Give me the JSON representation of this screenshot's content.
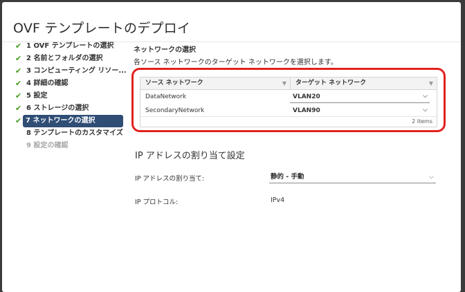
{
  "dialog": {
    "title": "OVF テンプレートのデプロイ"
  },
  "steps": [
    {
      "label": "1 OVF テンプレートの選択",
      "state": "done"
    },
    {
      "label": "2 名前とフォルダの選択",
      "state": "done"
    },
    {
      "label": "3 コンピューティング リソー...",
      "state": "done"
    },
    {
      "label": "4 詳細の確認",
      "state": "done"
    },
    {
      "label": "5 設定",
      "state": "done"
    },
    {
      "label": "6 ストレージの選択",
      "state": "done"
    },
    {
      "label": "7 ネットワークの選択",
      "state": "active"
    },
    {
      "label": "8 テンプレートのカスタマイズ",
      "state": "pending-bold"
    },
    {
      "label": "9 設定の確認",
      "state": "pending"
    }
  ],
  "network": {
    "title": "ネットワークの選択",
    "description": "各ソース ネットワークのターゲット ネットワークを選択します。",
    "columns": [
      "ソース ネットワーク",
      "ターゲット ネットワーク"
    ],
    "rows": [
      {
        "source": "DataNetwork",
        "target": "VLAN20"
      },
      {
        "source": "SecondaryNetwork",
        "target": "VLAN90"
      }
    ],
    "count": "2 items"
  },
  "ip": {
    "section_title": "IP アドレスの割り当て設定",
    "alloc_label": "IP アドレスの割り当て:",
    "alloc_value": "静的 - 手動",
    "protocol_label": "IP プロトコル:",
    "protocol_value": "IPv4"
  },
  "icons": {
    "check": "✔",
    "filter": "▼",
    "chevron": "⌵"
  },
  "colors": {
    "active_step": "#2f4d75",
    "check": "#3f9b1c",
    "highlight": "#e0221e"
  }
}
